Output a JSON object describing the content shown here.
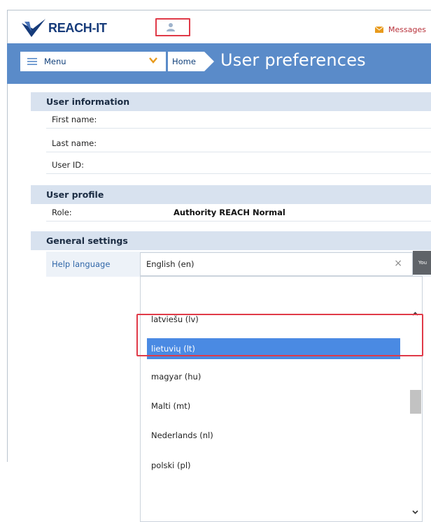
{
  "app": {
    "logo_text": "REACH-IT",
    "messages_label": "Messages"
  },
  "nav": {
    "menu_label": "Menu",
    "home_label": "Home",
    "page_title": "User preferences"
  },
  "sections": {
    "user_information": {
      "title": "User information",
      "fields": [
        {
          "label": "First name:",
          "value": ""
        },
        {
          "label": "Last name:",
          "value": ""
        },
        {
          "label": "User ID:",
          "value": ""
        }
      ]
    },
    "user_profile": {
      "title": "User profile",
      "fields": [
        {
          "label": "Role:",
          "value": "Authority REACH Normal"
        }
      ]
    },
    "general_settings": {
      "title": "General settings",
      "help_language": {
        "label": "Help language",
        "selected": "English (en)",
        "options": [
          "latviešu (lv)",
          "lietuvių (lt)",
          "magyar (hu)",
          "Malti (mt)",
          "Nederlands (nl)",
          "polski (pl)"
        ],
        "highlighted": "lietuvių (lt)"
      }
    }
  },
  "tooltip_text": "You",
  "colors": {
    "nav": "#5a8bc9",
    "section": "#d8e2ef",
    "selected": "#4a8ae3",
    "highlight_box": "#e03a48",
    "brand": "#163b7a"
  },
  "icons": {
    "logo": "reach-logo-icon",
    "user": "user-icon",
    "messages": "envelope-icon",
    "menu": "hamburger-icon",
    "chevron": "chevron-down-icon",
    "clear": "clear-x-icon"
  }
}
